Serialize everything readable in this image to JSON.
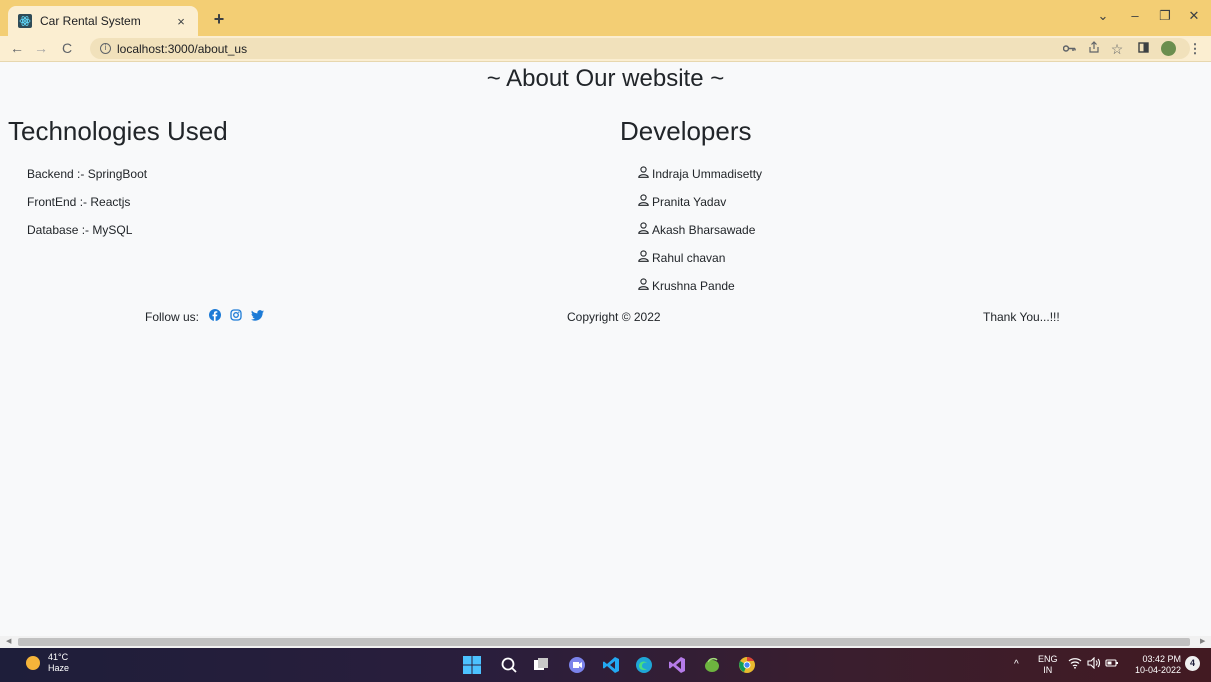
{
  "browser": {
    "tab_title": "Car Rental System",
    "tab_close": "×",
    "new_tab": "+",
    "url": "localhost:3000/about_us",
    "controls": {
      "dropdown": "⌄",
      "minimize": "–",
      "restore": "❐",
      "close": "✕"
    },
    "nav": {
      "back": "←",
      "forward": "→",
      "reload": "C"
    }
  },
  "page": {
    "title": "~ About Our website ~",
    "technologies": {
      "heading": "Technologies Used",
      "items": [
        "Backend :- SpringBoot",
        "FrontEnd :- Reactjs",
        "Database :- MySQL"
      ]
    },
    "developers": {
      "heading": "Developers",
      "items": [
        "Indraja Ummadisetty",
        "Pranita Yadav",
        "Akash Bharsawade",
        "Rahul chavan",
        "Krushna Pande"
      ]
    },
    "footer": {
      "follow_label": "Follow us:",
      "copyright": "Copyright © 2022",
      "thanks": "Thank You...!!!"
    }
  },
  "taskbar": {
    "temperature": "41°C",
    "weather": "Haze",
    "language_top": "ENG",
    "language_bottom": "IN",
    "time": "03:42 PM",
    "date": "10-04-2022",
    "notifications": "4"
  },
  "colors": {
    "social_blue": "#1d7bd6",
    "tabstrip": "#f3ce74"
  },
  "icons": [
    "react-favicon-icon",
    "info-icon",
    "key-icon",
    "share-icon",
    "star-icon",
    "sidebar-icon",
    "menu-icon",
    "user-icon",
    "facebook-icon",
    "instagram-icon",
    "twitter-icon"
  ]
}
